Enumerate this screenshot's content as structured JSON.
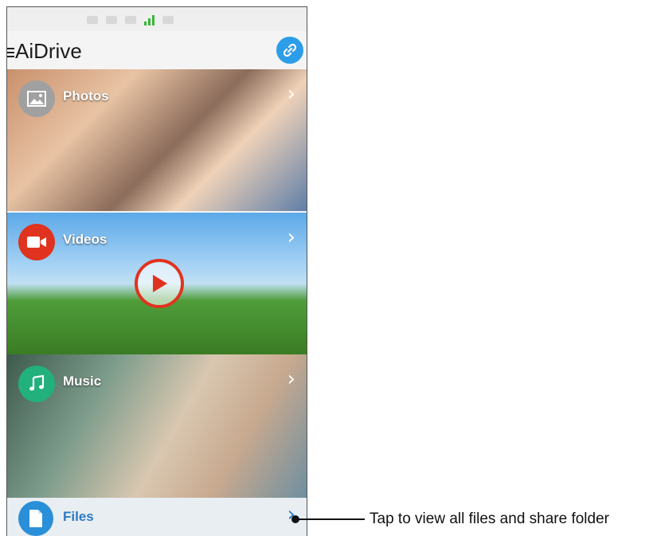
{
  "app": {
    "title": "AiDrive"
  },
  "tiles": [
    {
      "label": "Photos",
      "icon": "image-icon",
      "icon_color": "#a0a0a0"
    },
    {
      "label": "Videos",
      "icon": "video-camera-icon",
      "icon_color": "#e0331f"
    },
    {
      "label": "Music",
      "icon": "music-note-icon",
      "icon_color": "#22b07d"
    }
  ],
  "files": {
    "label": "Files",
    "icon": "file-icon",
    "icon_color": "#2a8fd9"
  },
  "callout": {
    "text": "Tap to view all files and share folder"
  },
  "colors": {
    "accent": "#2c9de8",
    "signal": "#36b83a"
  }
}
